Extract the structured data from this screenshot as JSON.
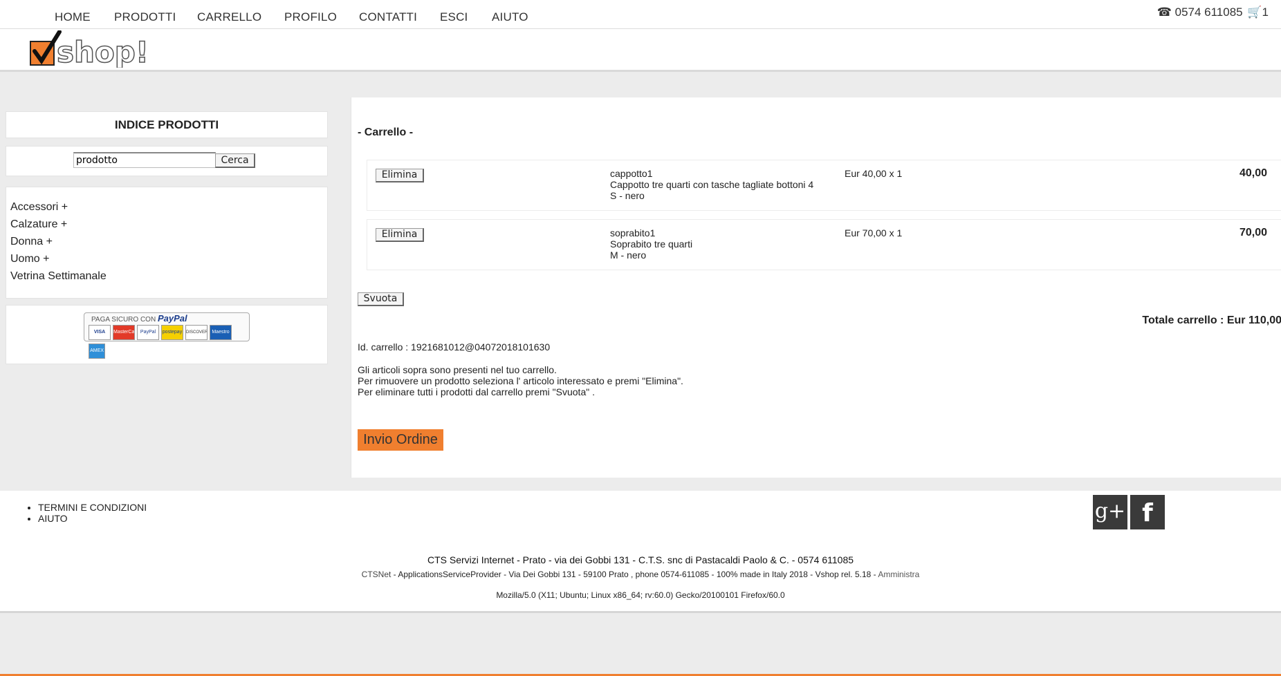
{
  "nav": {
    "items": [
      "HOME",
      "PRODOTTI",
      "CARRELLO",
      "PROFILO",
      "CONTATTI",
      "ESCI",
      "AIUTO"
    ],
    "phone": "0574 611085",
    "cart_count": "1"
  },
  "logo": {
    "text": "shop!",
    "accent": "#f07f2f"
  },
  "sidebar": {
    "title": "INDICE PRODOTTI",
    "search_value": "prodotto",
    "search_button": "Cerca",
    "categories": [
      "Accessori +",
      "Calzature +",
      "Donna +",
      "Uomo +",
      "Vetrina Settimanale"
    ],
    "paypal_heading": "PAGA SICURO CON",
    "paypal_brand": "PayPal",
    "cards": [
      "VISA",
      "MasterCard",
      "PayPal",
      "postepay",
      "DISCOVER",
      "Maestro",
      "AMEX"
    ]
  },
  "cart": {
    "title": "- Carrello -",
    "delete_label": "Elimina",
    "items": [
      {
        "name": "cappotto1",
        "description": "Cappotto tre quarti con tasche tagliate bottoni 4",
        "variant": "S - nero",
        "unit": "Eur 40,00 x 1",
        "price": "40,00"
      },
      {
        "name": "soprabito1",
        "description": "Soprabito tre quarti",
        "variant": "M - nero",
        "unit": "Eur 70,00 x 1",
        "price": "70,00"
      }
    ],
    "empty_label": "Svuota",
    "total": "Totale carrello : Eur 110,00",
    "cart_id": "Id. carrello : 1921681012@04072018101630",
    "info_lines": [
      "Gli articoli sopra sono presenti nel tuo carrello.",
      "Per rimuovere un prodotto seleziona l' articolo interessato e premi \"Elimina\".",
      "Per eliminare tutti i prodotti dal carrello premi \"Svuota\" ."
    ],
    "order_label": "Invio Ordine"
  },
  "footer": {
    "links": [
      "TERMINI E CONDIZIONI",
      "AIUTO"
    ],
    "company": "CTS Servizi Internet - Prato - via dei Gobbi 131 - C.T.S. snc di Pastacaldi Paolo & C. - 0574 611085",
    "ctsnet": "CTSNet",
    "details": " - ApplicationsServiceProvider - Via Dei Gobbi 131 - 59100 Prato , phone 0574-611085 - 100% made in Italy 2018 - Vshop rel. 5.18 - ",
    "admin": "Amministra",
    "useragent": "Mozilla/5.0 (X11; Ubuntu; Linux x86_64; rv:60.0) Gecko/20100101 Firefox/60.0",
    "social": [
      "g+",
      "f"
    ]
  }
}
